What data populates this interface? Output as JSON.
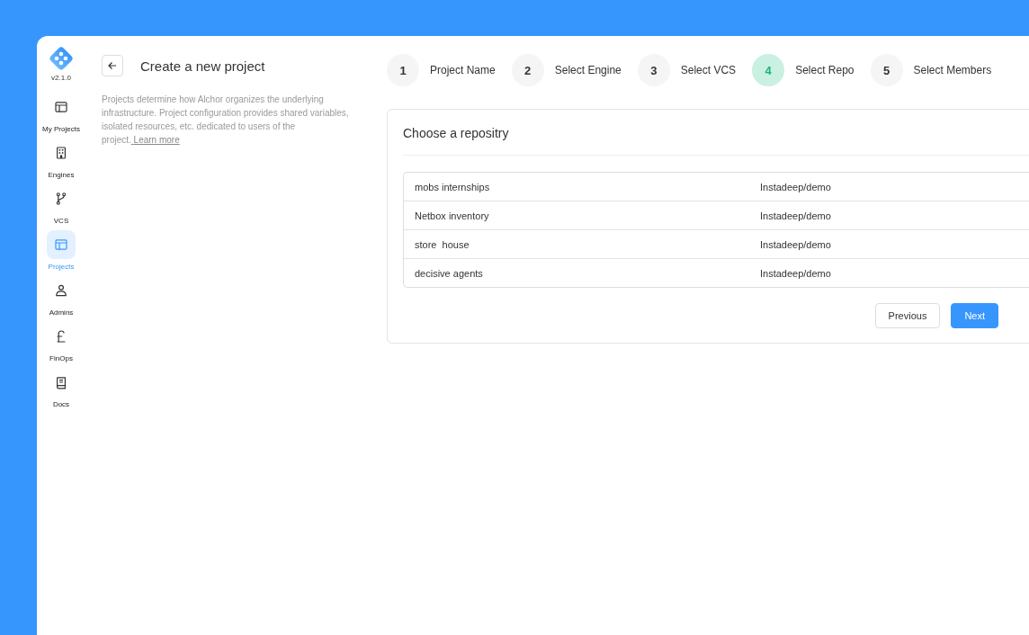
{
  "app": {
    "version": "v2.1.0"
  },
  "sidebar": {
    "items": [
      {
        "label": "My Projects",
        "kind": "layout",
        "selected": false
      },
      {
        "label": "Engines",
        "kind": "building",
        "selected": false
      },
      {
        "label": "VCS",
        "kind": "branch",
        "selected": false
      },
      {
        "label": "Projects",
        "kind": "layout",
        "selected": true
      },
      {
        "label": "Admins",
        "kind": "people",
        "selected": false
      },
      {
        "label": "FinOps",
        "kind": "pound",
        "selected": false
      },
      {
        "label": "Docs",
        "kind": "book",
        "selected": false
      }
    ]
  },
  "header": {
    "title": "Create a new project",
    "description": "Projects determine how Alchor organizes the underlying infrastructure.  Project configuration provides shared variables, isolated resources,  etc. dedicated to users of the project.",
    "link": "Learn more"
  },
  "steps": [
    {
      "number": "1",
      "label": "Project Name",
      "selected": false
    },
    {
      "number": "2",
      "label": "Select Engine",
      "selected": false
    },
    {
      "number": "3",
      "label": "Select VCS",
      "selected": false
    },
    {
      "number": "4",
      "label": "Select Repo",
      "selected": true
    },
    {
      "number": "5",
      "label": "Select Members",
      "selected": false
    }
  ],
  "card": {
    "title": "Choose a repositry",
    "rows": [
      {
        "name": "mobs internships",
        "source": "Instadeep/demo"
      },
      {
        "name": "Netbox inventory",
        "source": "Instadeep/demo"
      },
      {
        "name": "store  house",
        "source": "Instadeep/demo"
      },
      {
        "name": "decisive agents",
        "source": "Instadeep/demo"
      }
    ],
    "buttons": [
      {
        "label": "Previous",
        "kind": "secondary"
      },
      {
        "label": "Next",
        "kind": "primary"
      }
    ]
  }
}
